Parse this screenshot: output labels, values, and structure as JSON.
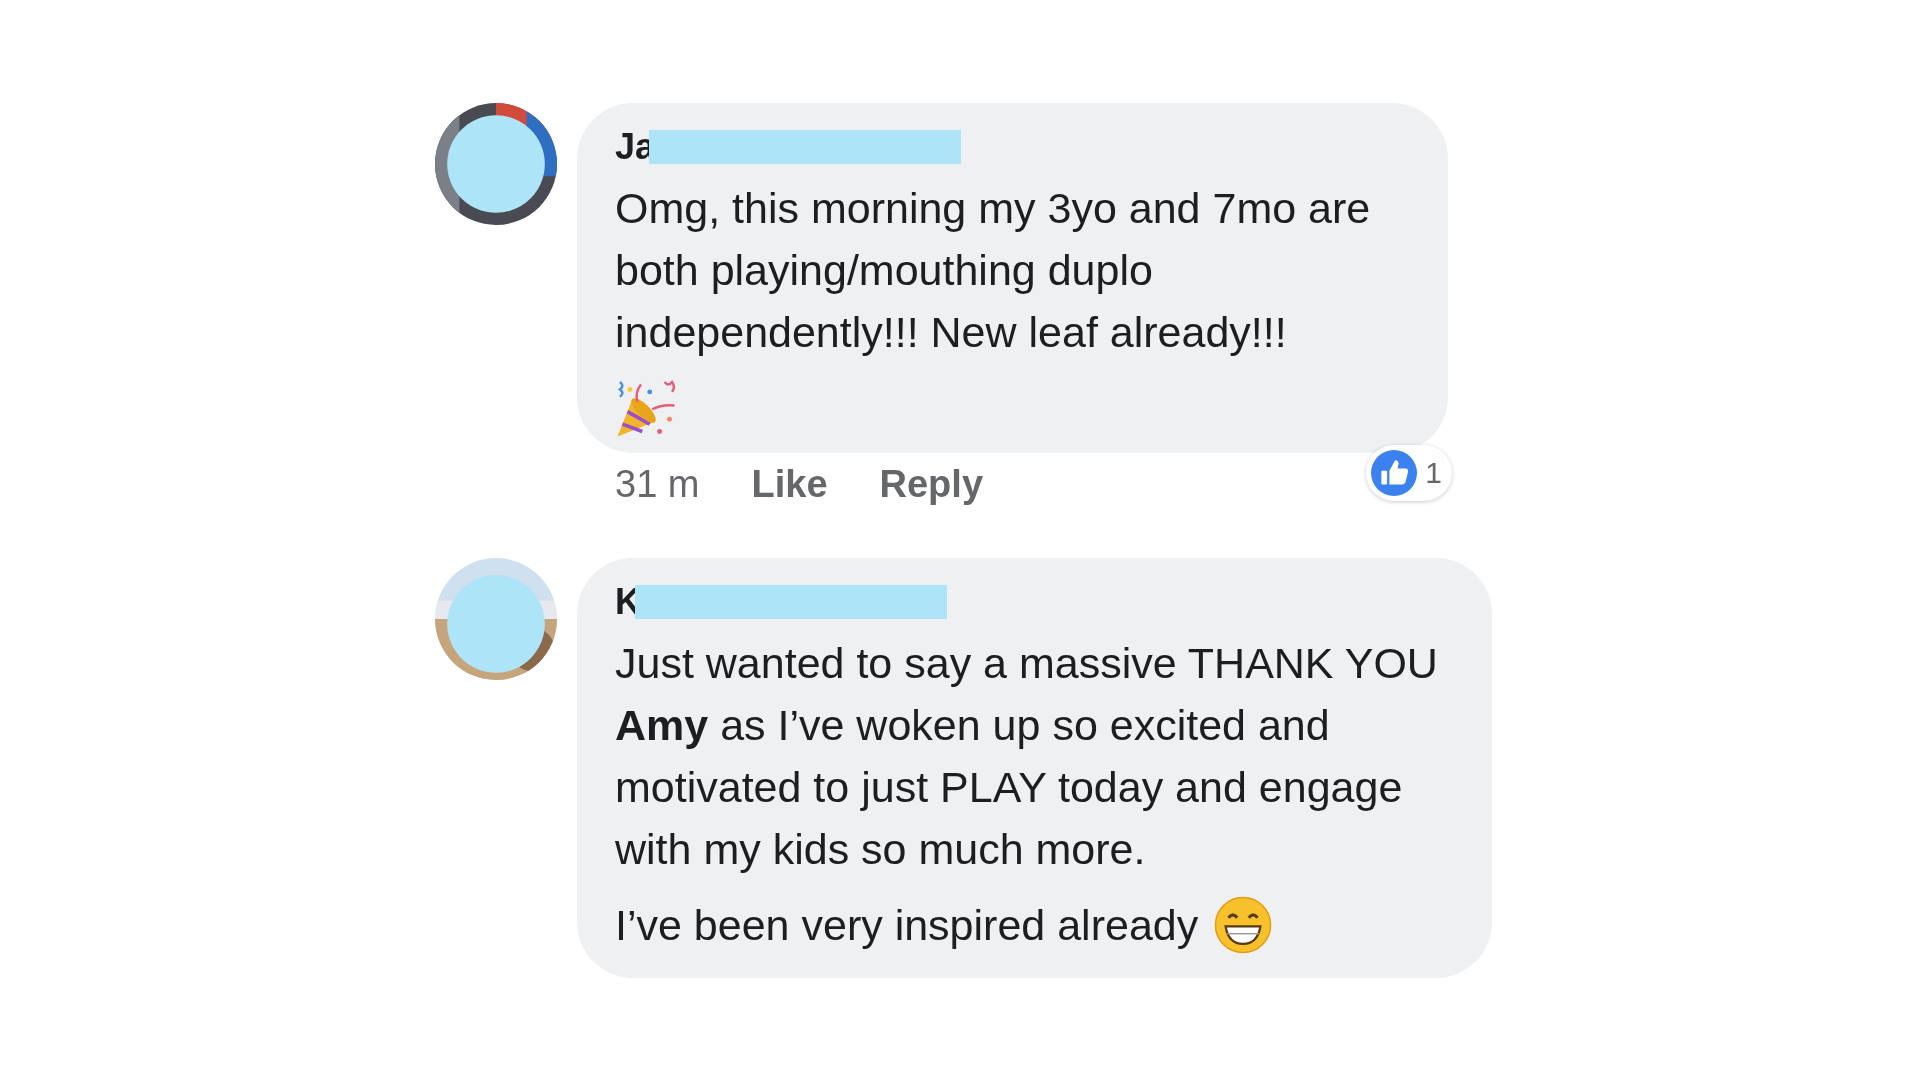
{
  "comments": [
    {
      "author": "Ja",
      "blocks": [
        {
          "kind": "text",
          "text": "Omg, this morning my 3yo and 7mo are both playing/mouthing duplo independently!!! New leaf already!!!"
        },
        {
          "kind": "popper"
        }
      ],
      "time": "31 m",
      "actions": [
        "Like",
        "Reply"
      ],
      "reaction_count": "1"
    },
    {
      "author": "K",
      "blocks": [
        {
          "kind": "text",
          "text": "Just wanted to say a massive THANK YOU **Amy** as I’ve woken up so excited and motivated to just PLAY today and engage with my kids so much more."
        },
        {
          "kind": "text-grin",
          "text": "I’ve been very inspired already"
        }
      ]
    }
  ]
}
